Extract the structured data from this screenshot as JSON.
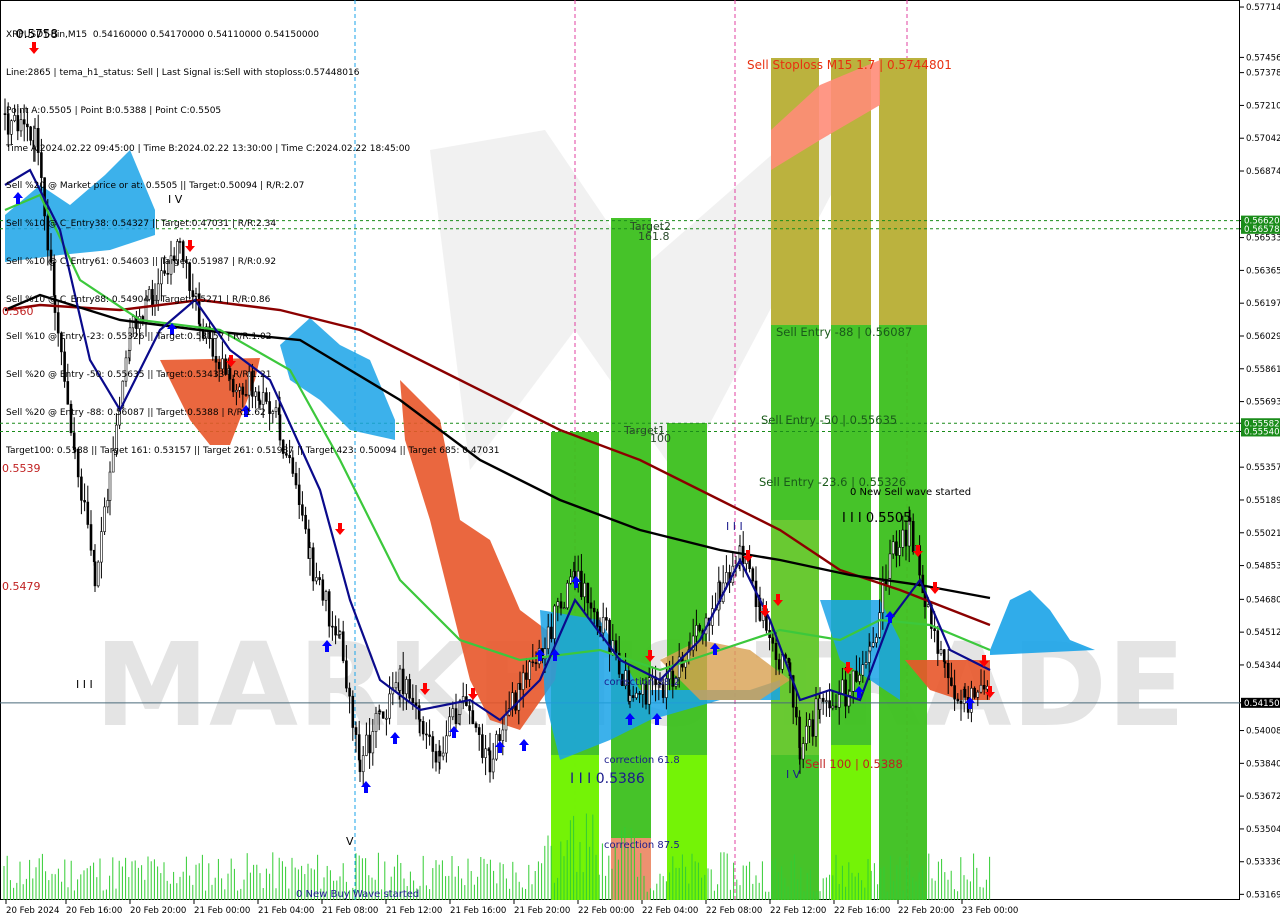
{
  "header": {
    "lines": [
      "XRPUSDT-Bin,M15  0.54160000 0.54170000 0.54110000 0.54150000",
      "Line:2865 | tema_h1_status: Sell | Last Signal is:Sell with stoploss:0.57448016",
      "Point A:0.5505 | Point B:0.5388 | Point C:0.5505",
      "Time A:2024.02.22 09:45:00 | Time B:2024.02.22 13:30:00 | Time C:2024.02.22 18:45:00",
      "Sell %20 @ Market price or at: 0.5505 || Target:0.50094 | R/R:2.07",
      "Sell %10 @ C_Entry38: 0.54327 || Target:0.47031 | R/R:2.34",
      "Sell %10 @ C_Entry61: 0.54603 || Target:0.51987 | R/R:0.92",
      "Sell %10 @ C_Entry88: 0.54904 || Target:0.5271 | R/R:0.86",
      "Sell %10 @ Entry -23: 0.55326 || Target:0.53157 | R/R:1.02",
      "Sell %20 @ Entry -50: 0.55635 || Target:0.53433 | R/R:1.21",
      "Sell %20 @ Entry -88: 0.56087 || Target:0.5388 | R/R:1.62",
      "Target100: 0.5388 || Target 161: 0.53157 || Target 261: 0.51987 || Target 423: 0.50094 || Target 685: 0.47031"
    ]
  },
  "watermark": "MARKETS TRADE",
  "colors": {
    "ichimoku_blue": "#1aa3e8",
    "ichimoku_orange": "#e8562a",
    "zone_green": "#3cc01e",
    "zone_lime": "#7cfc00",
    "zone_salmon": "#ff8c78",
    "zone_gold": "#c8b040",
    "ma_navy": "#0a0a8c",
    "ma_green": "#3cc83c",
    "ma_darkred": "#8b0000",
    "ma_black": "#000000",
    "arrow_up": "#0000ff",
    "arrow_down": "#ff0000",
    "level_line": "#1a8c1a",
    "price_line": "#4a6a7a",
    "volume": "#33cc33"
  },
  "chart_data": {
    "type": "candlestick",
    "symbol": "XRPUSDT-Bin",
    "timeframe": "M15",
    "ylim": [
      0.5314,
      0.5775
    ],
    "y_ticks": [
      "0.57714",
      "0.57456",
      "0.57378",
      "0.57210",
      "0.57042",
      "0.56874",
      "0.56620",
      "0.56578",
      "0.56533",
      "0.56365",
      "0.56197",
      "0.56029",
      "0.55861",
      "0.55693",
      "0.55582",
      "0.55540",
      "0.55357",
      "0.55189",
      "0.55021",
      "0.54853",
      "0.54680",
      "0.54512",
      "0.54344",
      "0.54150",
      "0.54008",
      "0.53840",
      "0.53672",
      "0.53504",
      "0.53336",
      "0.53169"
    ],
    "x_ticks": [
      "20 Feb 2024",
      "20 Feb 16:00",
      "20 Feb 20:00",
      "21 Feb 00:00",
      "21 Feb 04:00",
      "21 Feb 08:00",
      "21 Feb 12:00",
      "21 Feb 16:00",
      "21 Feb 20:00",
      "22 Feb 00:00",
      "22 Feb 04:00",
      "22 Feb 08:00",
      "22 Feb 12:00",
      "22 Feb 16:00",
      "22 Feb 20:00",
      "23 Feb 00:00"
    ],
    "current_price": "0.54150",
    "levels": [
      {
        "value": 0.5662,
        "label": "0.56620",
        "color": "#1a8c1a"
      },
      {
        "value": 0.56578,
        "label": "0.56578",
        "color": "#1a8c1a"
      },
      {
        "value": 0.55582,
        "label": "0.55582",
        "color": "#1a8c1a"
      },
      {
        "value": 0.5554,
        "label": "0.55540",
        "color": "#1a8c1a"
      }
    ],
    "annotations": [
      {
        "text": "Sell Stoploss M15 1.7 | 0.5744801",
        "color": "#e83010"
      },
      {
        "text": "Sell Entry -88 | 0.56087",
        "color": "#1a5a1a"
      },
      {
        "text": "Sell Entry -50 | 0.55635",
        "color": "#1a5a1a"
      },
      {
        "text": "Sell Entry -23.6 | 0.55326",
        "color": "#1a5a1a"
      },
      {
        "text": "0 New Sell wave started",
        "color": "#000000"
      },
      {
        "text": "I I I 0.5505",
        "color": "#000000"
      },
      {
        "text": "Sell 100 | 0.5388",
        "color": "#c02020"
      },
      {
        "text": "Target2",
        "color": "#2a4a2a"
      },
      {
        "text": "161.8",
        "color": "#2a4a2a"
      },
      {
        "text": "Target1",
        "color": "#2a4a2a"
      },
      {
        "text": "100",
        "color": "#2a4a2a"
      },
      {
        "text": "correction 38.2",
        "color": "#1a1a8c"
      },
      {
        "text": "correction 61.8",
        "color": "#1a1a8c"
      },
      {
        "text": "correction 87.5",
        "color": "#1a1a8c"
      },
      {
        "text": "I I I 0.5386",
        "color": "#1a1a8c"
      },
      {
        "text": "0 New Buy Wave started",
        "color": "#1a1a8c"
      },
      {
        "text": "0.5758",
        "color": "#000000"
      },
      {
        "text": "0.5539",
        "color": "#c02020"
      },
      {
        "text": "0.5479",
        "color": "#c02020"
      },
      {
        "text": "0.560",
        "color": "#c02020"
      },
      {
        "text": "I V",
        "color": "#000000"
      },
      {
        "text": "I I I",
        "color": "#000000"
      },
      {
        "text": "I V",
        "color": "#1a1a8c"
      },
      {
        "text": "I I I",
        "color": "#1a1a8c"
      },
      {
        "text": "V",
        "color": "#000000"
      }
    ]
  }
}
